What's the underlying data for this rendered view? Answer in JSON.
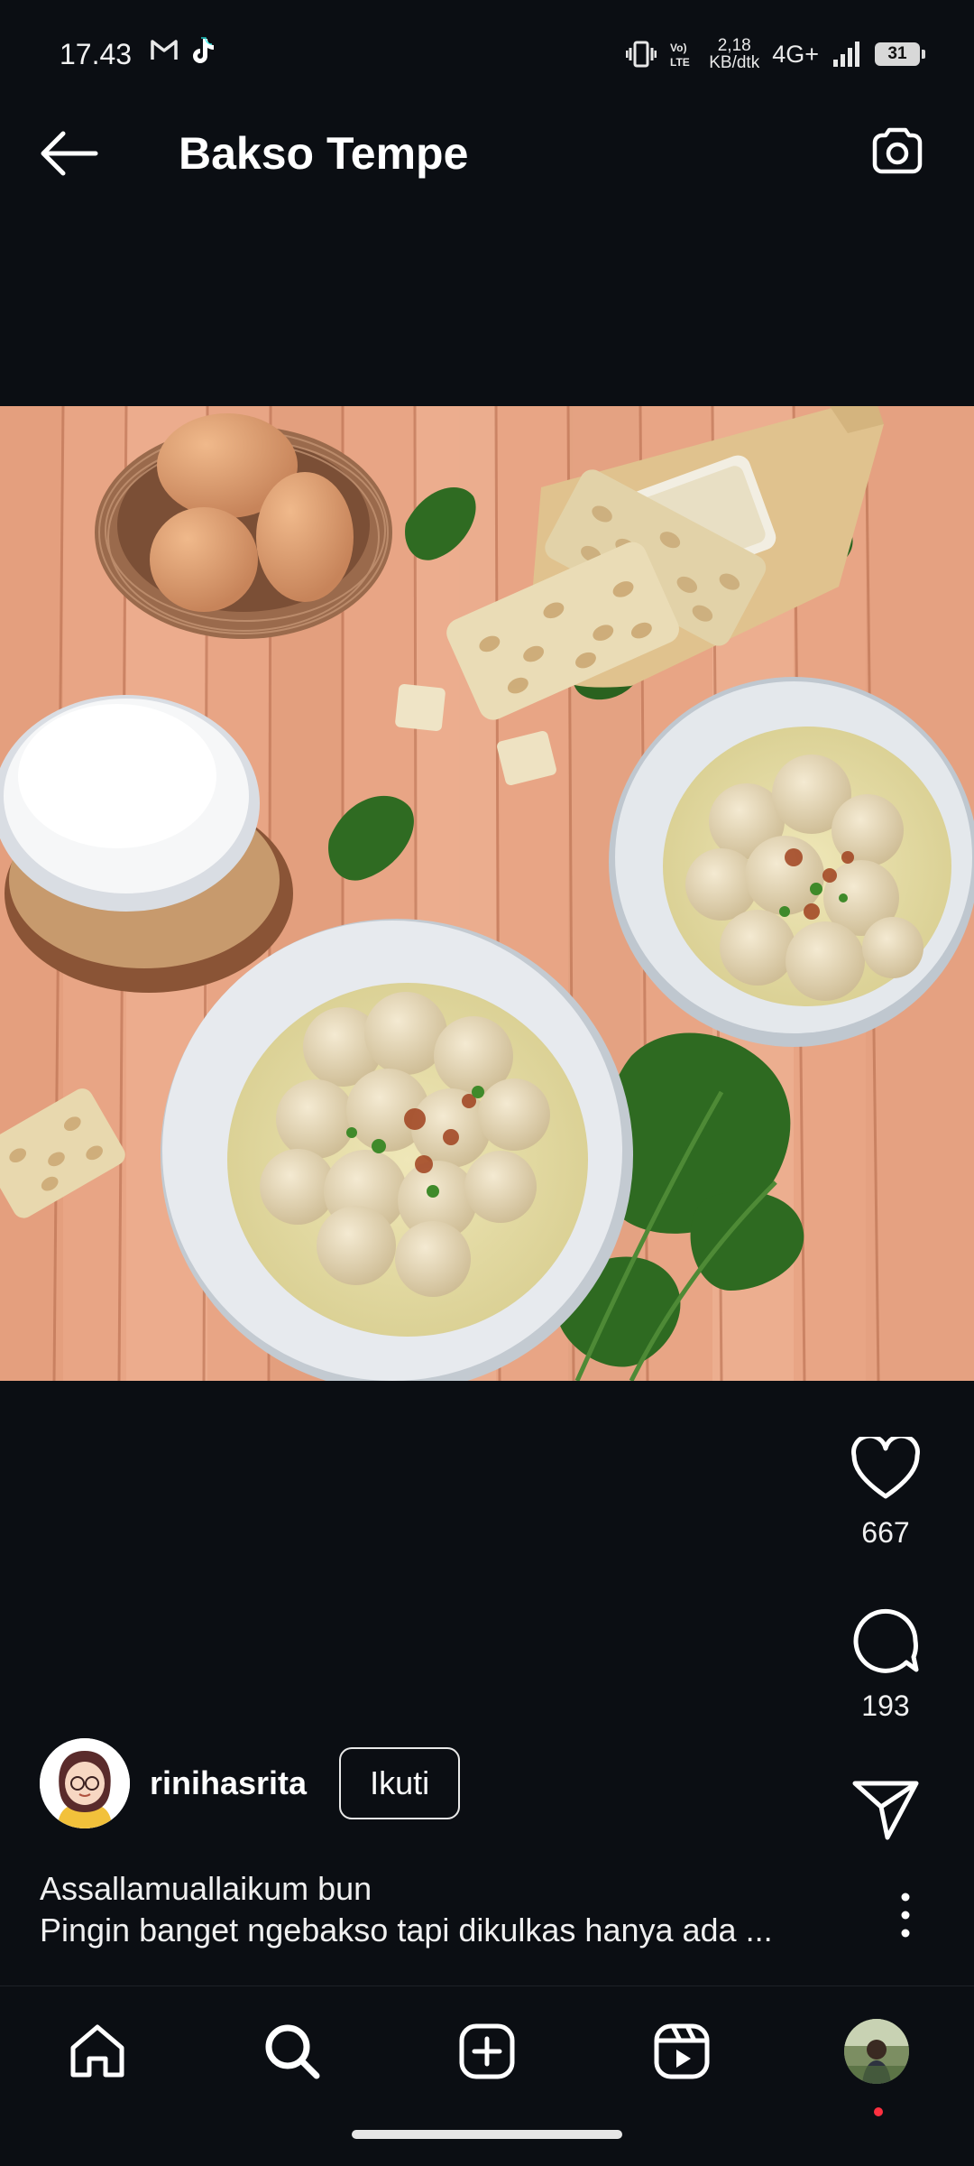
{
  "status_bar": {
    "time": "17.43",
    "net_speed_value": "2,18",
    "net_speed_unit": "KB/dtk",
    "network": "4G+",
    "battery": "31",
    "icons": [
      "gmail-icon",
      "tiktok-icon",
      "vibrate-icon",
      "volte-icon",
      "signal-icon",
      "battery-icon"
    ]
  },
  "header": {
    "title": "Bakso Tempe",
    "back_icon": "arrow-left-icon",
    "camera_icon": "camera-icon"
  },
  "post": {
    "image_subject": "photo",
    "likes": "667",
    "comments": "193",
    "author": "rinihasrita",
    "follow_label": "Ikuti",
    "caption_line1": "Assallamuallaikum bun",
    "caption_line2": "Pingin banget ngebakso tapi dikulkas hanya ada ..."
  },
  "bottom_nav": {
    "items": [
      "home-icon",
      "search-icon",
      "create-icon",
      "reels-icon",
      "profile-avatar"
    ]
  },
  "colors": {
    "background": "#0b0e13",
    "text": "#ffffff",
    "notification_dot": "#ff3040"
  }
}
